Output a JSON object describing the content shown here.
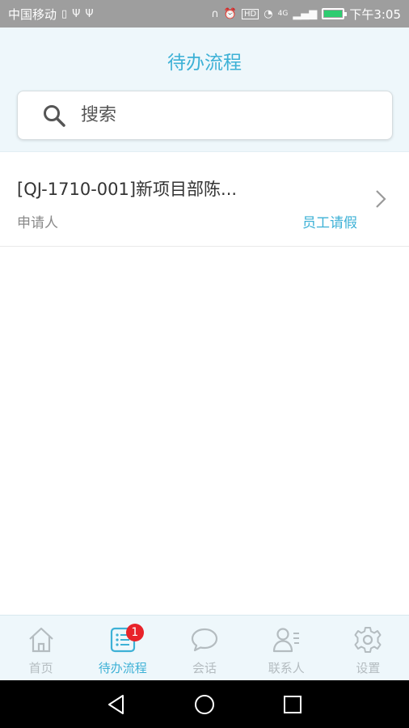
{
  "status_bar": {
    "carrier": "中国移动",
    "network": "4G",
    "time": "下午3:05",
    "icons": [
      "sim-icon",
      "usb-icon",
      "usb-icon",
      "headset-icon",
      "alarm-icon",
      "hd-icon",
      "wifi-icon",
      "signal-icon",
      "battery-icon"
    ]
  },
  "header": {
    "title": "待办流程"
  },
  "search": {
    "placeholder": "搜索"
  },
  "list": {
    "items": [
      {
        "title": "[QJ-1710-001]新项目部陈...",
        "applicant_label": "申请人",
        "type": "员工请假"
      }
    ]
  },
  "tabs": [
    {
      "label": "首页",
      "icon": "home-icon"
    },
    {
      "label": "待办流程",
      "icon": "todo-list-icon",
      "badge": "1",
      "active": true
    },
    {
      "label": "会话",
      "icon": "chat-bubble-icon"
    },
    {
      "label": "联系人",
      "icon": "contacts-icon"
    },
    {
      "label": "设置",
      "icon": "gear-icon"
    }
  ],
  "colors": {
    "accent": "#3db1d6",
    "header_bg": "#eef7fb",
    "badge": "#e8232a",
    "inactive": "#b4bcc0"
  }
}
